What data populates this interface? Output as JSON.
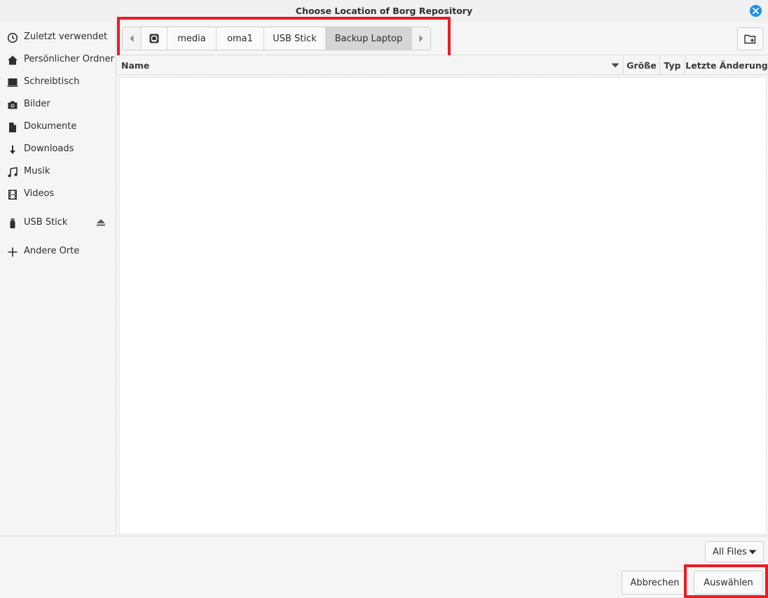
{
  "window": {
    "title": "Choose Location of Borg Repository",
    "accent_color": "#1e90ea",
    "highlight_color": "#ea1c24"
  },
  "sidebar": {
    "items": [
      {
        "label": "Zuletzt verwendet",
        "icon": "clock-icon"
      },
      {
        "label": "Persönlicher Ordner",
        "icon": "home-icon"
      },
      {
        "label": "Schreibtisch",
        "icon": "desktop-icon"
      },
      {
        "label": "Bilder",
        "icon": "camera-icon"
      },
      {
        "label": "Dokumente",
        "icon": "document-icon"
      },
      {
        "label": "Downloads",
        "icon": "download-icon"
      },
      {
        "label": "Musik",
        "icon": "music-icon"
      },
      {
        "label": "Videos",
        "icon": "film-icon"
      },
      {
        "label": "USB Stick",
        "icon": "usb-drive-icon"
      },
      {
        "label": "Andere Orte",
        "icon": "plus-icon"
      }
    ]
  },
  "pathbar": {
    "segments": [
      "media",
      "oma1",
      "USB Stick",
      "Backup Laptop"
    ],
    "active": "Backup Laptop"
  },
  "columns": {
    "name": "Name",
    "size": "Größe",
    "type": "Typ",
    "modified": "Letzte Änderung"
  },
  "footer": {
    "filter_label": "All Files",
    "cancel_label": "Abbrechen",
    "select_label": "Auswählen"
  }
}
